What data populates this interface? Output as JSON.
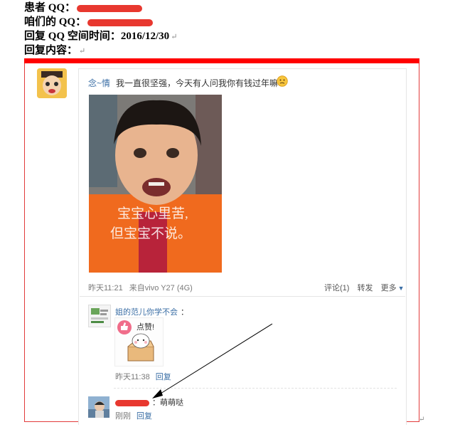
{
  "header": {
    "patient_qq_label": "患者 QQ：",
    "our_qq_label": "咱们的 QQ：",
    "reply_time_label": "回复 QQ 空间时间：",
    "reply_time_value": "2016/12/30",
    "reply_content_label": "回复内容：",
    "return_mark": "↵"
  },
  "post": {
    "username": "念~情",
    "text": "我一直很坚强，今天有人问我你有钱过年嘛",
    "image_caption_line1": "宝宝心里苦,",
    "image_caption_line2": "但宝宝不说。",
    "time": "昨天11:21",
    "source": "来自vivo Y27 (4G)",
    "actions": {
      "comment": "评论(1)",
      "forward": "转发",
      "more": "更多"
    }
  },
  "comments": [
    {
      "name": "姐的范儿你学不会",
      "colon": "：",
      "sticker_text": "点赞!",
      "time": "昨天11:38",
      "reply_label": "回复"
    },
    {
      "reply_text": "：萌萌哒",
      "time": "刚刚",
      "reply_label": "回复"
    }
  ],
  "colors": {
    "accent_red": "#ff0000",
    "link_blue": "#3a6ea5"
  },
  "icons": {
    "caret": "chevron-down-icon",
    "emoji": "confused-face-emoji-icon"
  }
}
